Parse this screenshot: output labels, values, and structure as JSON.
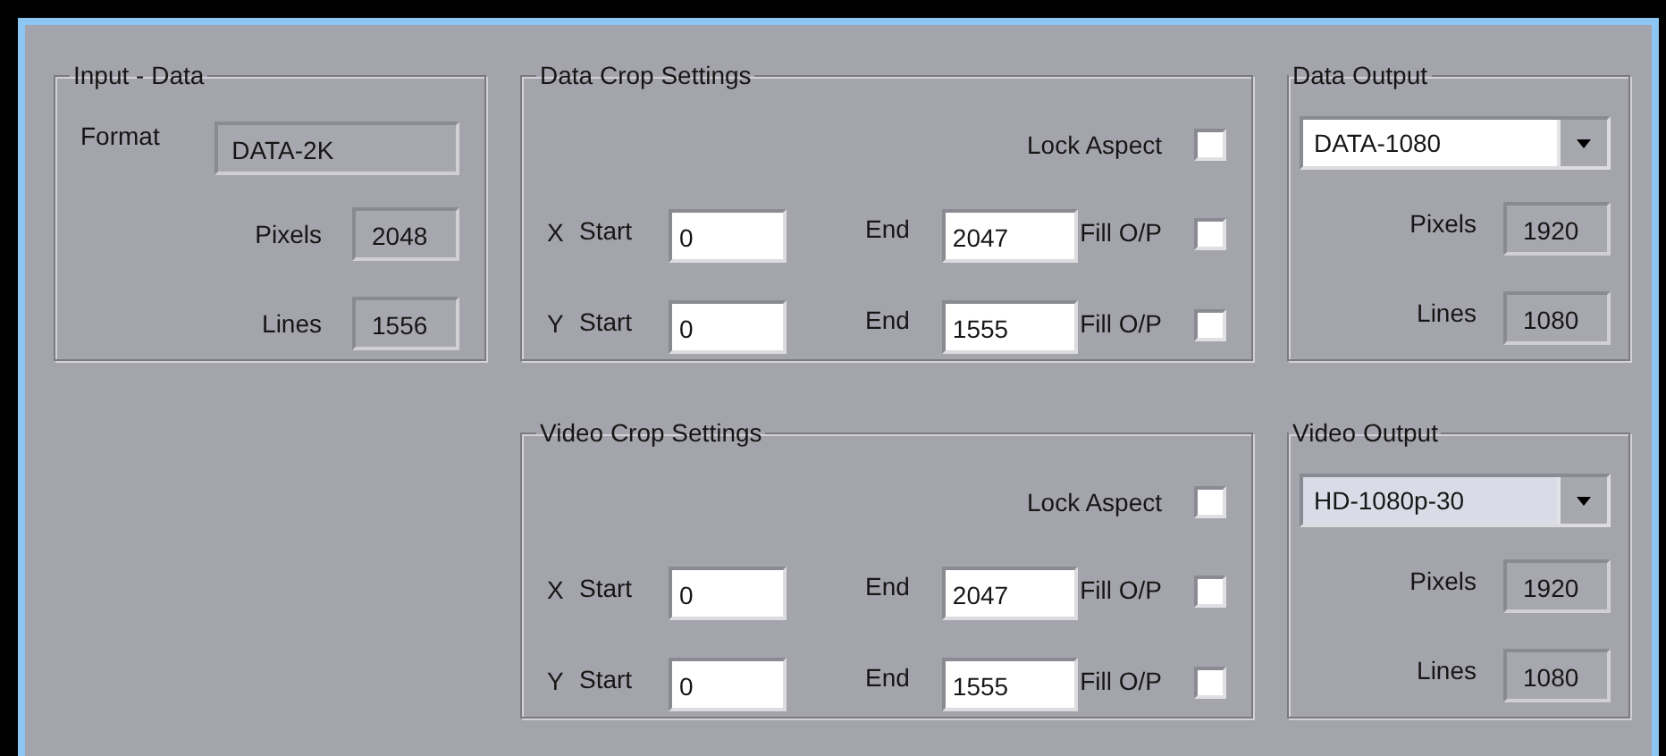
{
  "input_data": {
    "title": "Input - Data",
    "format_label": "Format",
    "format": "DATA-2K",
    "pixels_label": "Pixels",
    "pixels": "2048",
    "lines_label": "Lines",
    "lines": "1556"
  },
  "data_crop": {
    "title": "Data Crop Settings",
    "lock_aspect": {
      "label": "Lock Aspect",
      "checked": false
    },
    "rows": [
      {
        "axis": "X",
        "start_label": "Start",
        "start": "0",
        "end_label": "End",
        "end": "2047",
        "fill": {
          "label": "Fill O/P",
          "checked": false
        }
      },
      {
        "axis": "Y",
        "start_label": "Start",
        "start": "0",
        "end_label": "End",
        "end": "1555",
        "fill": {
          "label": "Fill O/P",
          "checked": false
        }
      }
    ]
  },
  "data_output": {
    "title": "Data Output",
    "format": "DATA-1080",
    "focused": false,
    "pixels_label": "Pixels",
    "pixels": "1920",
    "lines_label": "Lines",
    "lines": "1080"
  },
  "video_crop": {
    "title": "Video Crop Settings",
    "lock_aspect": {
      "label": "Lock Aspect",
      "checked": false
    },
    "rows": [
      {
        "axis": "X",
        "start_label": "Start",
        "start": "0",
        "end_label": "End",
        "end": "2047",
        "fill": {
          "label": "Fill O/P",
          "checked": false
        }
      },
      {
        "axis": "Y",
        "start_label": "Start",
        "start": "0",
        "end_label": "End",
        "end": "1555",
        "fill": {
          "label": "Fill O/P",
          "checked": false
        }
      }
    ]
  },
  "video_output": {
    "title": "Video Output",
    "format": "HD-1080p-30",
    "focused": true,
    "pixels_label": "Pixels",
    "pixels": "1920",
    "lines_label": "Lines",
    "lines": "1080"
  }
}
